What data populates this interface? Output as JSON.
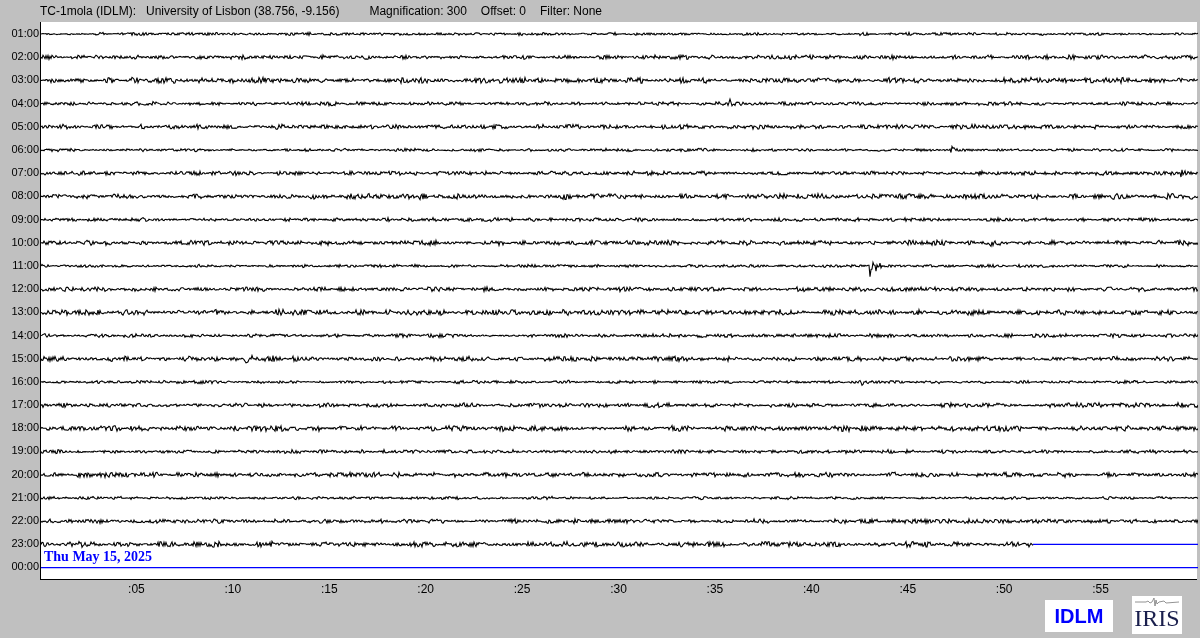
{
  "header": {
    "station": "TC-1mola (IDLM):",
    "location": "University of Lisbon (38.756, -9.156)",
    "magnification": "Magnification: 300",
    "offset": "Offset: 0",
    "filter": "Filter: None"
  },
  "rows": [
    {
      "label": "01:00",
      "kind": "full"
    },
    {
      "label": "02:00",
      "kind": "full"
    },
    {
      "label": "03:00",
      "kind": "full"
    },
    {
      "label": "04:00",
      "kind": "full"
    },
    {
      "label": "05:00",
      "kind": "full"
    },
    {
      "label": "06:00",
      "kind": "full"
    },
    {
      "label": "07:00",
      "kind": "full"
    },
    {
      "label": "08:00",
      "kind": "full"
    },
    {
      "label": "09:00",
      "kind": "full"
    },
    {
      "label": "10:00",
      "kind": "full"
    },
    {
      "label": "11:00",
      "kind": "full"
    },
    {
      "label": "12:00",
      "kind": "full"
    },
    {
      "label": "13:00",
      "kind": "full"
    },
    {
      "label": "14:00",
      "kind": "full"
    },
    {
      "label": "15:00",
      "kind": "full"
    },
    {
      "label": "16:00",
      "kind": "full"
    },
    {
      "label": "17:00",
      "kind": "full"
    },
    {
      "label": "18:00",
      "kind": "full"
    },
    {
      "label": "19:00",
      "kind": "full"
    },
    {
      "label": "20:00",
      "kind": "full"
    },
    {
      "label": "21:00",
      "kind": "full"
    },
    {
      "label": "22:00",
      "kind": "full"
    },
    {
      "label": "23:00",
      "kind": "partial"
    },
    {
      "label": "00:00",
      "kind": "empty"
    }
  ],
  "date": "Thu May 15, 2025",
  "x_ticks": [
    ":05",
    ":10",
    ":15",
    ":20",
    ":25",
    ":30",
    ":35",
    ":40",
    ":45",
    ":50",
    ":55"
  ],
  "logos": {
    "network": "IDLM",
    "iris": "IRIS"
  }
}
